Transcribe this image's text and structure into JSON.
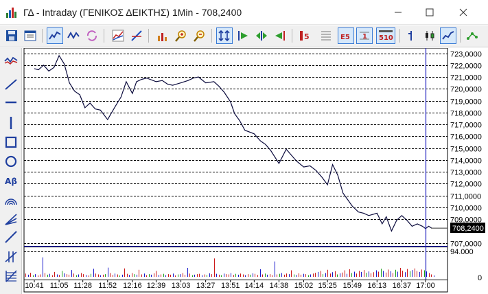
{
  "window": {
    "title": "ΓΔ - Intraday (ΓΕΝΙΚΟΣ ΔΕΙΚΤΗΣ) 1Min - 708,2400",
    "minimize_icon": "minimize-icon",
    "maximize_icon": "maximize-icon",
    "close_icon": "close-icon"
  },
  "toolbar": {
    "buttons": [
      {
        "name": "save-icon"
      },
      {
        "name": "properties-icon"
      },
      {
        "name": "line-chart-mode-icon",
        "active": true
      },
      {
        "name": "ohlc-mode-icon"
      },
      {
        "name": "refresh-icon"
      },
      {
        "name": "indicator-icon"
      },
      {
        "name": "study-icon"
      },
      {
        "name": "add-series-icon"
      },
      {
        "name": "zoom-in-icon"
      },
      {
        "name": "zoom-out-icon"
      },
      {
        "name": "fit-all-icon",
        "active": true
      },
      {
        "name": "go-start-icon"
      },
      {
        "name": "scroll-both-icon"
      },
      {
        "name": "go-end-icon"
      },
      {
        "name": "period-5-icon"
      },
      {
        "name": "grid-icon"
      },
      {
        "name": "period-e5-icon",
        "active": true
      },
      {
        "name": "period-1-icon",
        "active": true
      },
      {
        "name": "period-510-icon",
        "active": true
      },
      {
        "name": "bar-type-icon"
      },
      {
        "name": "candle-type-icon"
      },
      {
        "name": "line-type-icon",
        "active": true
      },
      {
        "name": "network-icon"
      }
    ],
    "labels": {
      "period5": "5",
      "periodE5": "E5",
      "period1": "1",
      "period510": "510"
    }
  },
  "drawing_tools": [
    "trend-chart-icon",
    "diagonal-line-icon",
    "horizontal-line-icon",
    "vertical-line-icon",
    "rectangle-icon",
    "ellipse-icon",
    "text-tool-icon",
    "arc-icon",
    "fan-icon",
    "pen-line-icon",
    "cross-line-icon",
    "fibonacci-icon"
  ],
  "text_tool_label": "Aβ",
  "colors": {
    "price_line": "#0a0a3c",
    "grid": "#000000",
    "volume_red": "#cc1a1a",
    "volume_blue": "#1a1acc",
    "volume_green": "#1aa01a",
    "cursor": "#1f1fbf",
    "price_tag_bg": "#000000"
  },
  "chart_data": {
    "type": "line",
    "title": "",
    "y_axis": {
      "min": 707,
      "max": 723,
      "ticks": [
        "723,0000",
        "722,0000",
        "721,0000",
        "720,0000",
        "719,0000",
        "718,0000",
        "717,0000",
        "716,0000",
        "715,0000",
        "714,0000",
        "713,0000",
        "712,0000",
        "711,0000",
        "710,0000",
        "709,0000",
        "707,0000"
      ],
      "tick_values": [
        723,
        722,
        721,
        720,
        719,
        718,
        717,
        716,
        715,
        714,
        713,
        712,
        711,
        710,
        709,
        707
      ]
    },
    "last_price_label": "708,2400",
    "volume_axis": {
      "ticks": [
        "94.000",
        "0"
      ],
      "max": 94000
    },
    "x_axis": {
      "ticks": [
        "10:41",
        "11:05",
        "11:28",
        "11:52",
        "12:16",
        "12:39",
        "13:03",
        "13:27",
        "13:51",
        "14:14",
        "14:38",
        "15:02",
        "15:25",
        "15:49",
        "16:13",
        "16:37",
        "17:00"
      ]
    },
    "series": [
      {
        "x": [
          "10:41",
          "10:45",
          "10:50",
          "10:55",
          "11:00",
          "11:05",
          "11:10",
          "11:15",
          "11:20",
          "11:25",
          "11:30",
          "11:35",
          "11:40",
          "11:45",
          "11:52",
          "12:00",
          "12:05",
          "12:10",
          "12:16",
          "12:20",
          "12:25",
          "12:30",
          "12:39",
          "12:45",
          "12:50",
          "12:55",
          "13:03",
          "13:10",
          "13:15",
          "13:20",
          "13:27",
          "13:35",
          "13:40",
          "13:45",
          "13:51",
          "13:55",
          "14:00",
          "14:05",
          "14:14",
          "14:20",
          "14:25",
          "14:30",
          "14:38",
          "14:45",
          "14:50",
          "14:55",
          "15:02",
          "15:08",
          "15:14",
          "15:20",
          "15:25",
          "15:30",
          "15:35",
          "15:40",
          "15:49",
          "15:55",
          "16:00",
          "16:05",
          "16:13",
          "16:18",
          "16:22",
          "16:27",
          "16:32",
          "16:37",
          "16:42",
          "16:47",
          "16:52",
          "16:57",
          "17:00",
          "17:03",
          "17:06"
        ],
        "values": [
          721.7,
          721.6,
          722.0,
          721.5,
          721.8,
          722.8,
          722.1,
          720.5,
          719.8,
          719.5,
          718.4,
          718.8,
          718.3,
          718.2,
          717.4,
          718.6,
          719.3,
          720.6,
          719.6,
          720.6,
          720.8,
          720.9,
          720.6,
          720.7,
          720.4,
          720.3,
          720.5,
          720.7,
          720.9,
          721.0,
          720.5,
          720.6,
          720.2,
          719.7,
          718.9,
          717.9,
          717.3,
          716.5,
          716.2,
          715.6,
          715.3,
          714.8,
          713.7,
          714.9,
          714.4,
          713.9,
          713.4,
          713.5,
          713.1,
          712.5,
          711.9,
          713.6,
          712.7,
          711.2,
          710.1,
          709.6,
          709.5,
          709.3,
          709.5,
          708.6,
          709.2,
          708.0,
          708.9,
          709.3,
          708.9,
          708.4,
          708.6,
          708.4,
          708.2,
          708.4,
          708.24
        ]
      }
    ],
    "volume_series": {
      "values": [
        12,
        8,
        15,
        6,
        10,
        5,
        9,
        72,
        14,
        8,
        11,
        6,
        18,
        9,
        7,
        22,
        13,
        10,
        8,
        25,
        12,
        6,
        9,
        14,
        10,
        7,
        5,
        11,
        30,
        12,
        9,
        6,
        8,
        10,
        34,
        14,
        7,
        12,
        9,
        5,
        8,
        31,
        11,
        7,
        14,
        10,
        8,
        26,
        9,
        12,
        6,
        10,
        8,
        13,
        22,
        7,
        9,
        11,
        6,
        10,
        8,
        12,
        5,
        9,
        10,
        14,
        7,
        33,
        12,
        6,
        8,
        10,
        11,
        6,
        9,
        7,
        13,
        10,
        68,
        11,
        8,
        6,
        12,
        10,
        9,
        14,
        7,
        11,
        8,
        12,
        9,
        6,
        10,
        8,
        13,
        11,
        7,
        28,
        9,
        12,
        8,
        10,
        6,
        57,
        9,
        11,
        14,
        8,
        12,
        10,
        24,
        9,
        7,
        13,
        8,
        11,
        10,
        6,
        9,
        12,
        15,
        18,
        22,
        10,
        14,
        26,
        12,
        17,
        21,
        9,
        13,
        16,
        24,
        11,
        28,
        14,
        19,
        12,
        22,
        18,
        25,
        15,
        20,
        13,
        17,
        24,
        19,
        30,
        22,
        16,
        27,
        21,
        14,
        26,
        19,
        33,
        23,
        17,
        29,
        21,
        25,
        31,
        22,
        18,
        27,
        24,
        20,
        14,
        9,
        5
      ],
      "colors": "mixed red/blue/green"
    },
    "ylim": [
      707,
      723
    ],
    "grid": "horizontal dashed",
    "cursor_time": "17:00"
  }
}
